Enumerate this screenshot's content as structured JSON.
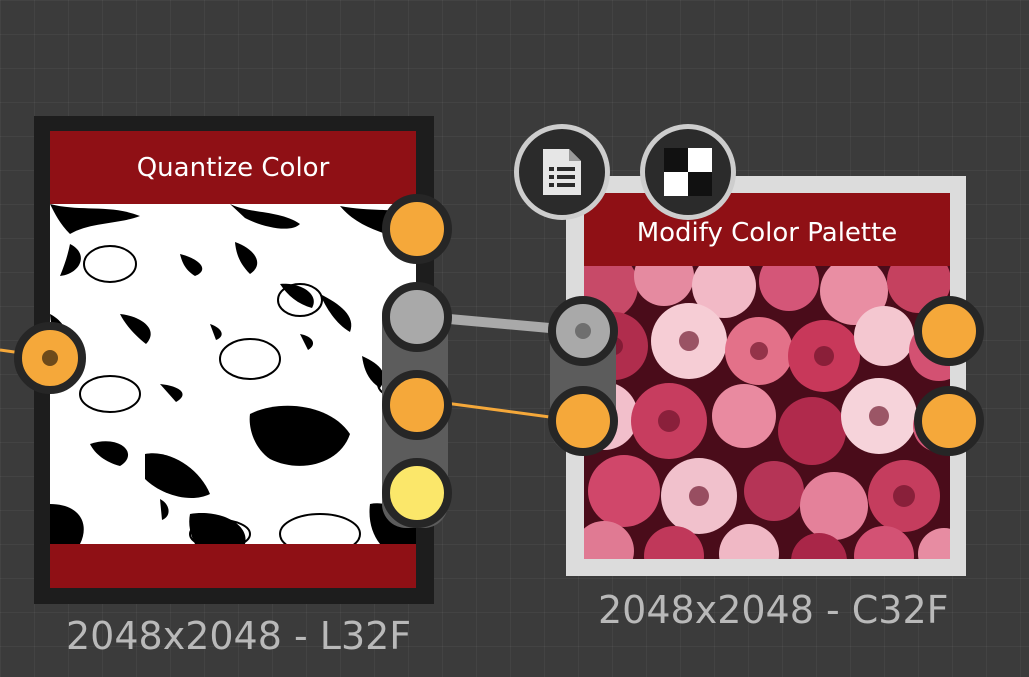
{
  "nodes": [
    {
      "title": "Quantize Color",
      "label": "2048x2048 - L32F"
    },
    {
      "title": "Modify Color Palette",
      "label": "2048x2048 - C32F"
    }
  ],
  "icons": {
    "document": "document-list-icon",
    "checker": "checkerboard-icon"
  },
  "colors": {
    "canvas": "#3b3b3b",
    "node_header": "#8f1015",
    "port_orange": "#f5a83a",
    "port_gray": "#a9a9a9",
    "port_yellow": "#fbe76a",
    "wire_orange": "#f5a83a",
    "wire_gray": "#a9a9a9"
  }
}
